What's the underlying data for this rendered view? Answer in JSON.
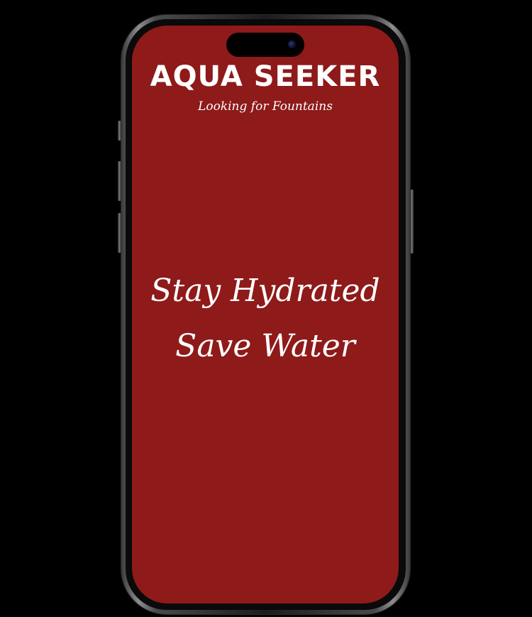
{
  "app": {
    "title": "AQUA SEEKER",
    "subtitle": "Looking for Fountains"
  },
  "splash": {
    "line1": "Stay Hydrated",
    "line2": "Save Water"
  },
  "colors": {
    "background": "#000000",
    "screen": "#8e1a1a",
    "text": "#ffffff"
  },
  "icons": [
    "camera-lens-icon"
  ]
}
